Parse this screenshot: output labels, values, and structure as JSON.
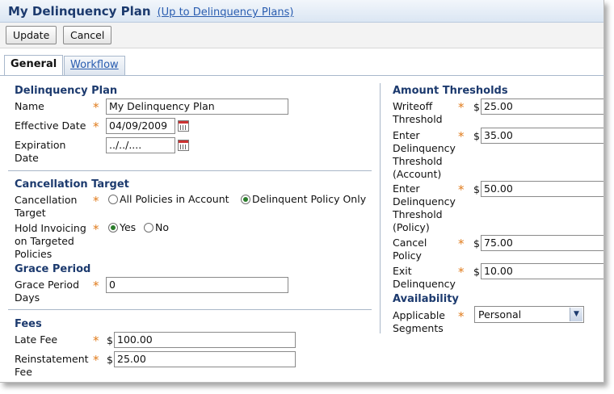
{
  "header": {
    "title": "My Delinquency Plan",
    "up_link": "(Up to Delinquency Plans)"
  },
  "toolbar": {
    "update_label": "Update",
    "cancel_label": "Cancel"
  },
  "tabs": [
    {
      "label": "General",
      "active": true
    },
    {
      "label": "Workflow",
      "active": false
    }
  ],
  "required_marker": "*",
  "currency_symbol": "$",
  "left": {
    "delinquency_plan": {
      "heading": "Delinquency Plan",
      "name_label": "Name",
      "name_value": "My Delinquency Plan",
      "effective_label": "Effective Date",
      "effective_value": "04/09/2009",
      "expiration_label": "Expiration Date",
      "expiration_value": "../../...."
    },
    "cancellation": {
      "heading": "Cancellation Target",
      "target_label": "Cancellation Target",
      "option_all": "All Policies in Account",
      "option_delinquent": "Delinquent Policy Only",
      "selected": "Delinquent Policy Only",
      "hold_label": "Hold Invoicing on Targeted Policies",
      "hold_yes": "Yes",
      "hold_no": "No",
      "hold_selected": "Yes"
    },
    "grace": {
      "heading": "Grace Period",
      "days_label": "Grace Period Days",
      "days_value": "0"
    },
    "fees": {
      "heading": "Fees",
      "late_label": "Late Fee",
      "late_value": "100.00",
      "reinstatement_label": "Reinstatement Fee",
      "reinstatement_value": "25.00"
    }
  },
  "right": {
    "thresholds": {
      "heading": "Amount Thresholds",
      "writeoff_label": "Writeoff Threshold",
      "writeoff_value": "25.00",
      "enter_account_label": "Enter Delinquency Threshold (Account)",
      "enter_account_value": "35.00",
      "enter_policy_label": "Enter Delinquency Threshold (Policy)",
      "enter_policy_value": "50.00",
      "cancel_label": "Cancel Policy",
      "cancel_value": "75.00",
      "exit_label": "Exit Delinquency",
      "exit_value": "10.00"
    },
    "availability": {
      "heading": "Availability",
      "segments_label": "Applicable Segments",
      "segments_value": "Personal"
    }
  },
  "colors": {
    "heading": "#1c3a6e",
    "required": "#e07b1c",
    "link": "#2a5db0"
  }
}
